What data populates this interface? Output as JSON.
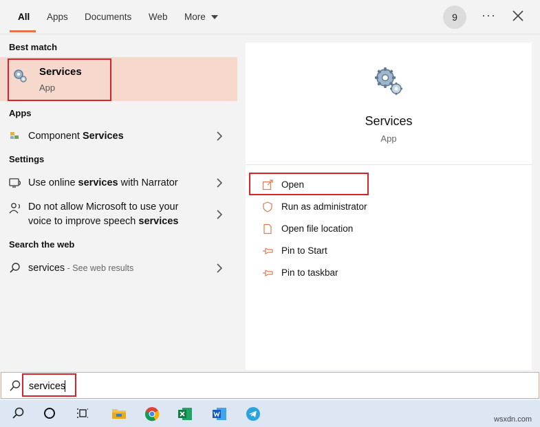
{
  "tabs": [
    {
      "label": "All",
      "active": true
    },
    {
      "label": "Apps"
    },
    {
      "label": "Documents"
    },
    {
      "label": "Web"
    },
    {
      "label": "More"
    }
  ],
  "header": {
    "badge_count": "9"
  },
  "left": {
    "best_match_heading": "Best match",
    "best_match": {
      "title": "Services",
      "subtitle": "App"
    },
    "apps_heading": "Apps",
    "apps": [
      {
        "pre": "Component ",
        "bold": "Services",
        "post": ""
      }
    ],
    "settings_heading": "Settings",
    "settings": [
      {
        "line1_pre": "Use online ",
        "line1_bold": "services",
        "line1_post": " with Narrator"
      },
      {
        "line1": "Do not allow Microsoft to use your",
        "line2_pre": "voice to improve speech ",
        "line2_bold": "services"
      }
    ],
    "web_heading": "Search the web",
    "web": {
      "query": "services",
      "suffix": " - See web results"
    }
  },
  "preview": {
    "title": "Services",
    "subtitle": "App",
    "actions": [
      {
        "label": "Open",
        "icon": "open-icon"
      },
      {
        "label": "Run as administrator",
        "icon": "shield-icon"
      },
      {
        "label": "Open file location",
        "icon": "folder-icon"
      },
      {
        "label": "Pin to Start",
        "icon": "pin-icon"
      },
      {
        "label": "Pin to taskbar",
        "icon": "pin-icon"
      }
    ]
  },
  "search": {
    "value": "services"
  },
  "taskbar": {
    "items": [
      "search-icon",
      "cortana-icon",
      "task-view-icon",
      "file-explorer-icon",
      "chrome-icon",
      "excel-icon",
      "word-icon",
      "telegram-icon"
    ]
  },
  "watermark": "wsxdn.com",
  "colors": {
    "accent": "#e8734a",
    "highlight": "#f7d8cd",
    "callout": "#d8222a",
    "taskbar": "#dce7f3"
  }
}
